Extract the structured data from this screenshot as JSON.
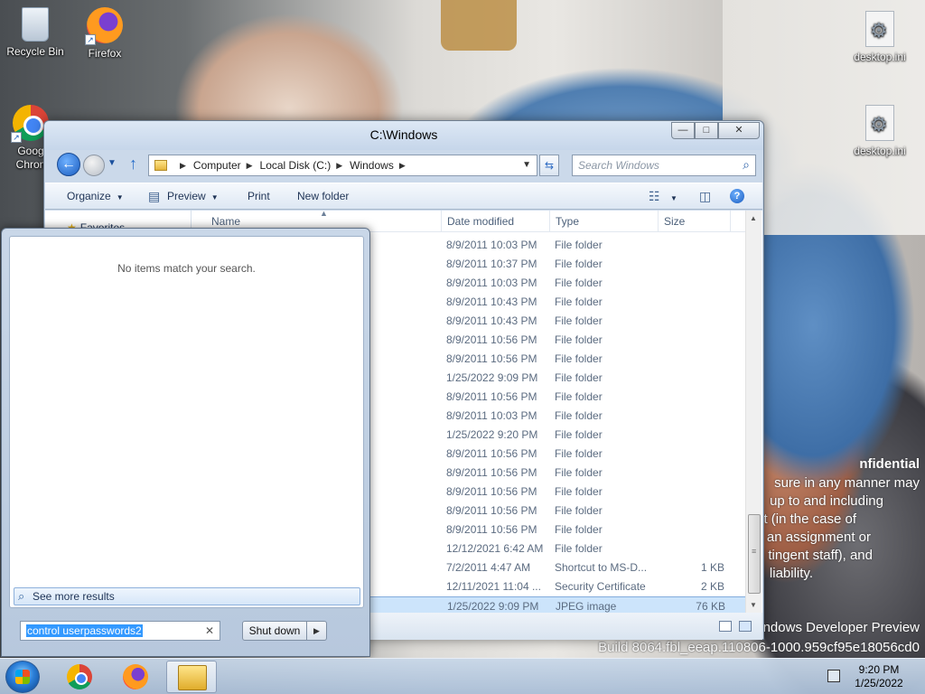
{
  "desktop": {
    "icons": [
      {
        "label": "Recycle Bin"
      },
      {
        "label": "Firefox"
      },
      {
        "label": "Goog Chron"
      },
      {
        "label": "desktop.ini"
      },
      {
        "label": "desktop.ini"
      }
    ],
    "watermark": {
      "line1": "nfidential",
      "line2": "sure in any manner may",
      "line3": "up to and including",
      "line4": "t (in the case of",
      "line5": "f an assignment or",
      "line6": "tingent staff), and",
      "line7": "liability.",
      "line8": "ndows Developer Preview",
      "line9": "Build 8064.fbl_eeap.110806-1000.959cf95e18056cd0"
    }
  },
  "explorer": {
    "title": "C:\\Windows",
    "breadcrumb": [
      "Computer",
      "Local Disk (C:)",
      "Windows"
    ],
    "search_placeholder": "Search Windows",
    "commands": {
      "organize": "Organize",
      "preview": "Preview",
      "print": "Print",
      "new_folder": "New folder"
    },
    "nav": {
      "favorites": "Favorites"
    },
    "columns": {
      "name": "Name",
      "date": "Date modified",
      "type": "Type",
      "size": "Size"
    },
    "rows": [
      {
        "date": "8/9/2011 10:03 PM",
        "type": "File folder",
        "size": ""
      },
      {
        "date": "8/9/2011 10:37 PM",
        "type": "File folder",
        "size": ""
      },
      {
        "date": "8/9/2011 10:03 PM",
        "type": "File folder",
        "size": ""
      },
      {
        "date": "8/9/2011 10:43 PM",
        "type": "File folder",
        "size": ""
      },
      {
        "date": "8/9/2011 10:43 PM",
        "type": "File folder",
        "size": ""
      },
      {
        "date": "8/9/2011 10:56 PM",
        "type": "File folder",
        "size": ""
      },
      {
        "date": "8/9/2011 10:56 PM",
        "type": "File folder",
        "size": ""
      },
      {
        "date": "1/25/2022 9:09 PM",
        "type": "File folder",
        "size": ""
      },
      {
        "date": "8/9/2011 10:56 PM",
        "type": "File folder",
        "size": ""
      },
      {
        "date": "8/9/2011 10:03 PM",
        "type": "File folder",
        "size": ""
      },
      {
        "date": "1/25/2022 9:20 PM",
        "type": "File folder",
        "size": ""
      },
      {
        "date": "8/9/2011 10:56 PM",
        "type": "File folder",
        "size": ""
      },
      {
        "date": "8/9/2011 10:56 PM",
        "type": "File folder",
        "size": ""
      },
      {
        "date": "8/9/2011 10:56 PM",
        "type": "File folder",
        "size": ""
      },
      {
        "date": "8/9/2011 10:56 PM",
        "type": "File folder",
        "size": ""
      },
      {
        "date": "8/9/2011 10:56 PM",
        "type": "File folder",
        "size": ""
      },
      {
        "date": "12/12/2021 6:42 AM",
        "type": "File folder",
        "size": ""
      },
      {
        "date": "7/2/2011 4:47 AM",
        "type": "Shortcut to MS-D...",
        "size": "1 KB"
      },
      {
        "date": "12/11/2021 11:04 ...",
        "type": "Security Certificate",
        "size": "2 KB"
      },
      {
        "date": "1/25/2022 9:09 PM",
        "type": "JPEG image",
        "size": "76 KB"
      }
    ],
    "selected_row": 19
  },
  "start_menu": {
    "no_results": "No items match your search.",
    "see_more": "See more results",
    "search_query": "control userpasswords2",
    "shutdown_label": "Shut down"
  },
  "taskbar": {
    "time": "9:20 PM",
    "date": "1/25/2022"
  }
}
